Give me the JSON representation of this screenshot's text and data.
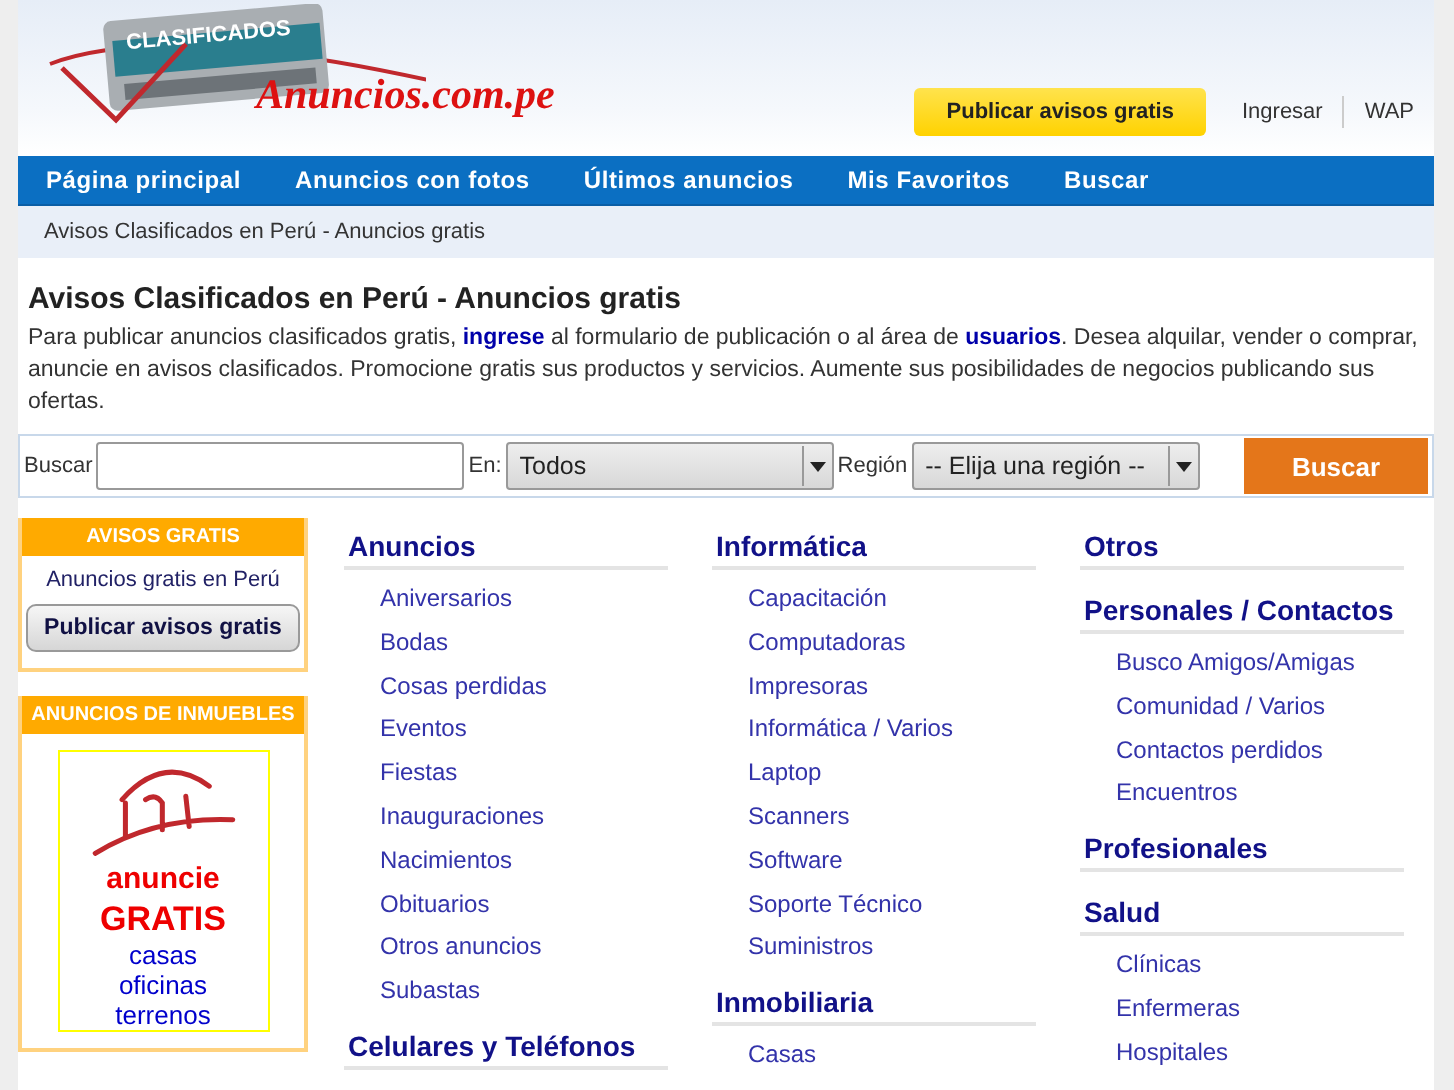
{
  "header": {
    "logo_badge": "CLASIFICADOS",
    "logo_text": "Anuncios.com.pe",
    "publish_button": "Publicar avisos gratis",
    "links": [
      "Ingresar",
      "WAP"
    ]
  },
  "nav": [
    "Página principal",
    "Anuncios con fotos",
    "Últimos anuncios",
    "Mis Favoritos",
    "Buscar"
  ],
  "breadcrumb": "Avisos Clasificados en Perú - Anuncios gratis",
  "title": "Avisos Clasificados en Perú - Anuncios gratis",
  "intro": "Para publicar anuncios clasificados gratis, **ingrese** al formulario de publicación o al área de **usuarios**. Desea alquilar, vender o comprar, anuncie en avisos clasificados. Promocione gratis sus productos y servicios. Aumente sus posibilidades de negocios publicando sus ofertas.",
  "search": {
    "label": "Buscar",
    "in_label": "En:",
    "in_value": "Todos",
    "region_label": "Región",
    "region_value": "-- Elija una región --",
    "button": "Buscar"
  },
  "sidebar": [
    {
      "kind": "button",
      "title": "AVISOS GRATIS",
      "text": "Anuncios gratis en Perú",
      "button": "Publicar avisos gratis"
    },
    {
      "kind": "banner",
      "title": "ANUNCIOS DE INMUEBLES",
      "lines": [
        "anuncie",
        "GRATIS",
        "casas",
        "oficinas",
        "terrenos"
      ]
    }
  ],
  "columns": [
    [
      {
        "title": "Anuncios",
        "items": [
          "Aniversarios",
          "Bodas",
          "Cosas perdidas",
          "Eventos",
          "Fiestas",
          "Inauguraciones",
          "Nacimientos",
          "Obituarios",
          "Otros anuncios",
          "Subastas"
        ]
      },
      {
        "title": "Celulares y Teléfonos"
      }
    ],
    [
      {
        "title": "Informática",
        "items": [
          "Capacitación",
          "Computadoras",
          "Impresoras",
          "Informática / Varios",
          "Laptop",
          "Scanners",
          "Software",
          "Soporte Técnico",
          "Suministros"
        ]
      },
      {
        "title": "Inmobiliaria",
        "items": [
          "Casas"
        ]
      }
    ],
    [
      {
        "title": "Otros"
      },
      {
        "title": "Personales / Contactos",
        "items": [
          "Busco Amigos/Amigas",
          "Comunidad / Varios",
          "Contactos perdidos",
          "Encuentros"
        ]
      },
      {
        "title": "Profesionales"
      },
      {
        "title": "Salud",
        "items": [
          "Clínicas",
          "Enfermeras",
          "Hospitales"
        ]
      }
    ]
  ]
}
